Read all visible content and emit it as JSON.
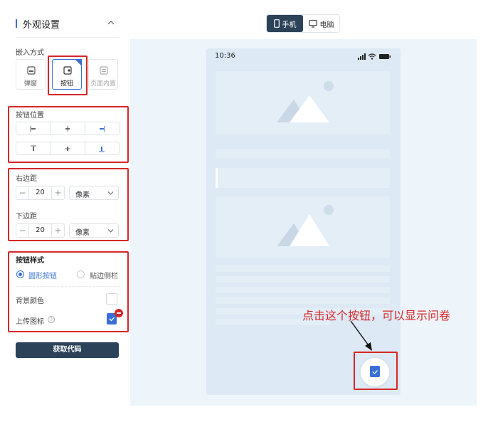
{
  "panel": {
    "title": "外观设置",
    "embed_label": "嵌入方式",
    "embed_options": [
      {
        "label": "弹窗"
      },
      {
        "label": "按钮"
      },
      {
        "label": "页面内置"
      }
    ],
    "button_position_label": "按钮位置",
    "right_margin_label": "右边距",
    "right_margin_value": "20",
    "bottom_margin_label": "下边距",
    "bottom_margin_value": "20",
    "unit": "像素",
    "button_style_label": "按钮样式",
    "style_options": [
      {
        "label": "圆形按钮",
        "selected": true
      },
      {
        "label": "贴边侧栏",
        "selected": false
      }
    ],
    "bg_color_label": "背景颜色",
    "upload_icon_label": "上传图标",
    "help_glyph": "?",
    "get_code_label": "获取代码"
  },
  "preview": {
    "device_options": [
      {
        "label": "手机",
        "active": true
      },
      {
        "label": "电脑",
        "active": false
      }
    ],
    "status_time": "10:36"
  },
  "annotation": {
    "text": "点击这个按钮，可以显示问卷"
  },
  "colors": {
    "accent": "#3a6fd8",
    "dark": "#2b4259",
    "annotation": "#d62728"
  }
}
